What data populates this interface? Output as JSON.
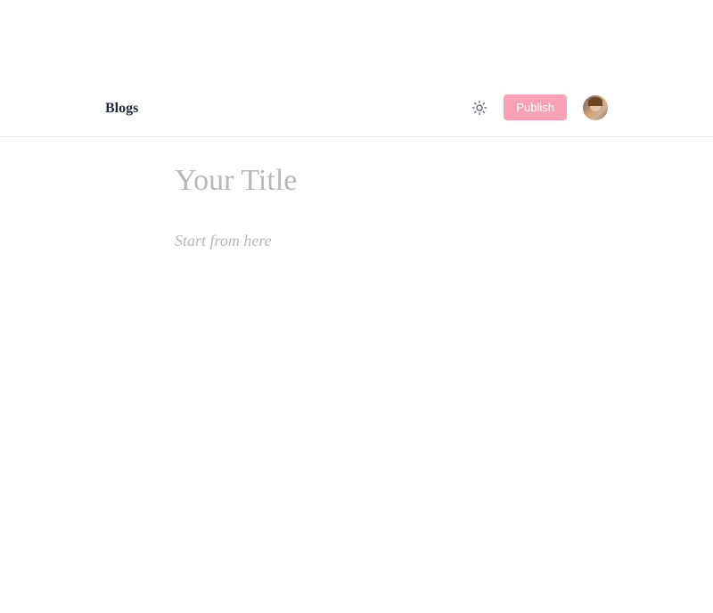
{
  "navbar": {
    "brand": "Blogs",
    "publish_label": "Publish"
  },
  "editor": {
    "title_value": "",
    "title_placeholder": "Your Title",
    "content_value": "",
    "content_placeholder": "Start from here"
  }
}
